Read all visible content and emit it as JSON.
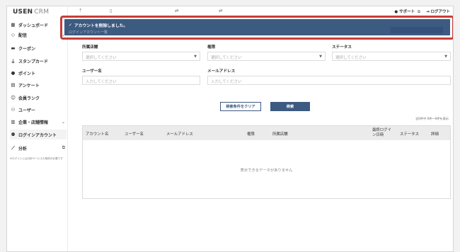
{
  "brand": {
    "name": "USEN",
    "suffix": "CRM"
  },
  "sidebar": {
    "items": [
      {
        "label": "ダッシュボード",
        "icon": "dashboard-icon",
        "glyph": "▦",
        "chevron": ""
      },
      {
        "label": "配信",
        "icon": "broadcast-icon",
        "glyph": "◇",
        "chevron": "⌄"
      },
      {
        "label": "クーポン",
        "icon": "coupon-icon",
        "glyph": "▬",
        "chevron": ""
      },
      {
        "label": "スタンプカード",
        "icon": "stamp-icon",
        "glyph": "⍊",
        "chevron": ""
      },
      {
        "label": "ポイント",
        "icon": "point-icon",
        "glyph": "●",
        "chevron": ""
      },
      {
        "label": "アンケート",
        "icon": "survey-icon",
        "glyph": "▤",
        "chevron": ""
      },
      {
        "label": "会員ランク",
        "icon": "rank-icon",
        "glyph": "☺",
        "chevron": ""
      },
      {
        "label": "ユーザー",
        "icon": "user-icon",
        "glyph": "⚇",
        "chevron": ""
      },
      {
        "label": "企業・店舗情報",
        "icon": "store-icon",
        "glyph": "▥",
        "chevron": "⌄"
      },
      {
        "label": "ログインアカウント",
        "icon": "account-icon",
        "glyph": "⚉",
        "chevron": ""
      },
      {
        "label": "分析",
        "icon": "analytics-icon",
        "glyph": "⟋",
        "chevron": "⧉"
      }
    ],
    "note": "※ログインには分析サービスの契約が必要です"
  },
  "topbar": {
    "support_label": "サポート",
    "logout_label": "ログアウト"
  },
  "toast": {
    "message": "アカウントを削除しました。",
    "underlying_title": "ログインアカウント一覧"
  },
  "filters": {
    "store": {
      "label": "所属店舗",
      "placeholder": "選択してください"
    },
    "role": {
      "label": "権限",
      "placeholder": "選択してください"
    },
    "status": {
      "label": "ステータス",
      "placeholder": "選択してください"
    },
    "username": {
      "label": "ユーザー名",
      "placeholder": "入力してください"
    },
    "email": {
      "label": "メールアドレス",
      "placeholder": "入力してください"
    }
  },
  "buttons": {
    "clear": "検索条件をクリア",
    "search": "検索"
  },
  "results": {
    "count_text": "全0件中 0件〜0件を表示"
  },
  "table": {
    "headers": [
      "アカウント名",
      "ユーザー名",
      "メールアドレス",
      "権限",
      "所属店舗",
      "最終ログイン日時",
      "ステータス",
      "詳細"
    ],
    "empty_text": "表示できるデータがありません"
  },
  "colors": {
    "primary": "#3d5a80",
    "highlight": "#c63d3a"
  }
}
